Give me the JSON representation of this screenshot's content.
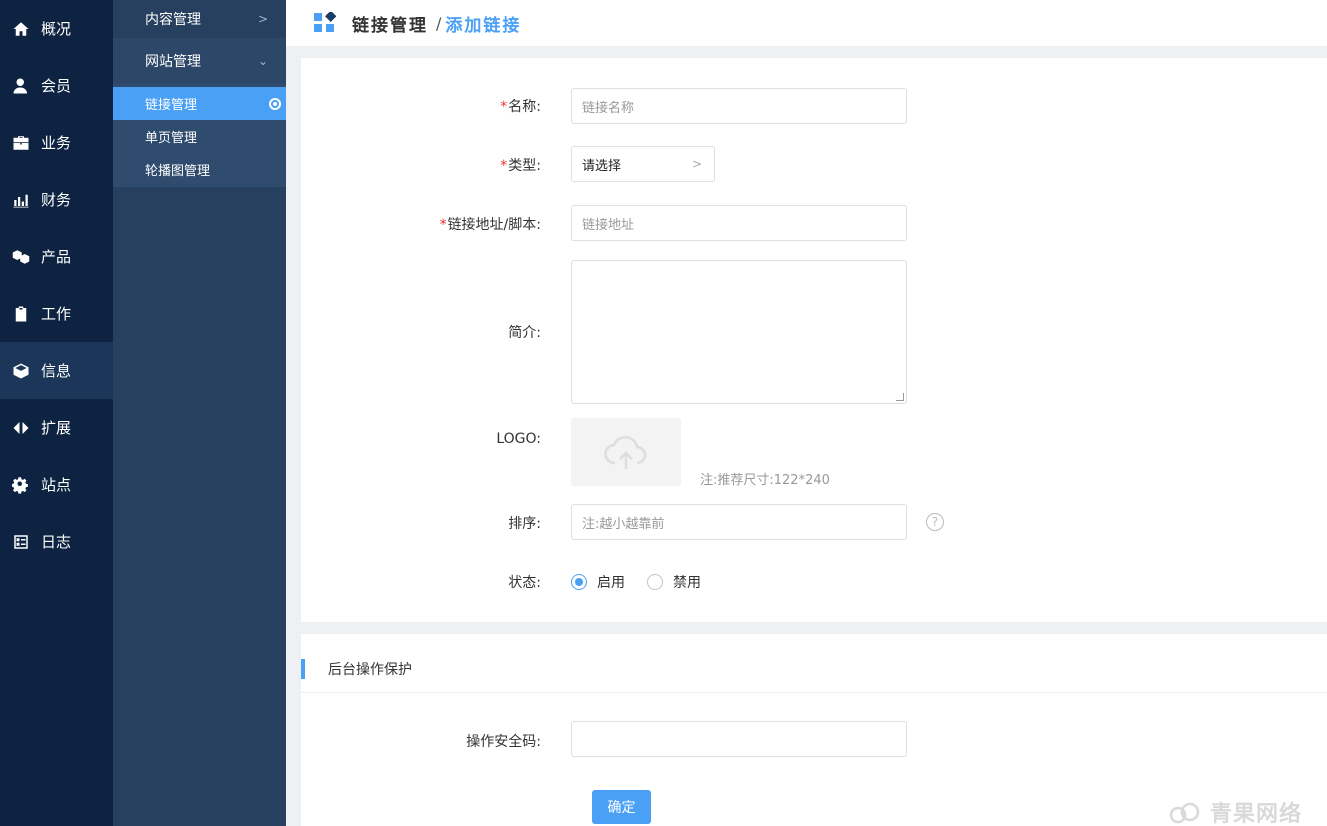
{
  "nav1": {
    "items": [
      {
        "label": "概况",
        "icon": "home-icon"
      },
      {
        "label": "会员",
        "icon": "user-icon"
      },
      {
        "label": "业务",
        "icon": "briefcase-icon"
      },
      {
        "label": "财务",
        "icon": "bar-chart-icon"
      },
      {
        "label": "产品",
        "icon": "cubes-icon"
      },
      {
        "label": "工作",
        "icon": "clipboard-icon"
      },
      {
        "label": "信息",
        "icon": "cube-icon"
      },
      {
        "label": "扩展",
        "icon": "expand-arrows-icon"
      },
      {
        "label": "站点",
        "icon": "gear-icon"
      },
      {
        "label": "日志",
        "icon": "checklist-icon"
      }
    ],
    "active": "信息"
  },
  "nav2": {
    "group1": "内容管理",
    "group2": "网站管理",
    "subitems": [
      "链接管理",
      "单页管理",
      "轮播图管理"
    ],
    "active_sub": "链接管理"
  },
  "header": {
    "title": "链接管理",
    "separator": "/",
    "subtitle": "添加链接"
  },
  "form": {
    "required_mark": "*",
    "name_label": "名称:",
    "name_placeholder": "链接名称",
    "type_label": "类型:",
    "type_value": "请选择",
    "url_label": "链接地址/脚本:",
    "url_placeholder": "链接地址",
    "intro_label": "简介:",
    "logo_label": "LOGO:",
    "logo_hint": "注:推荐尺寸:122*240",
    "sort_label": "排序:",
    "sort_placeholder": "注:越小越靠前",
    "help_glyph": "?",
    "status_label": "状态:",
    "status_options": [
      "启用",
      "禁用"
    ],
    "status_selected": "启用"
  },
  "protect": {
    "section_title": "后台操作保护",
    "code_label": "操作安全码:",
    "submit_label": "确定"
  },
  "watermark": "青果网络",
  "colors": {
    "nav1_bg": "#0d2341",
    "nav2_bg": "#27405f",
    "accent": "#4aa0f5",
    "required": "#e33333"
  }
}
